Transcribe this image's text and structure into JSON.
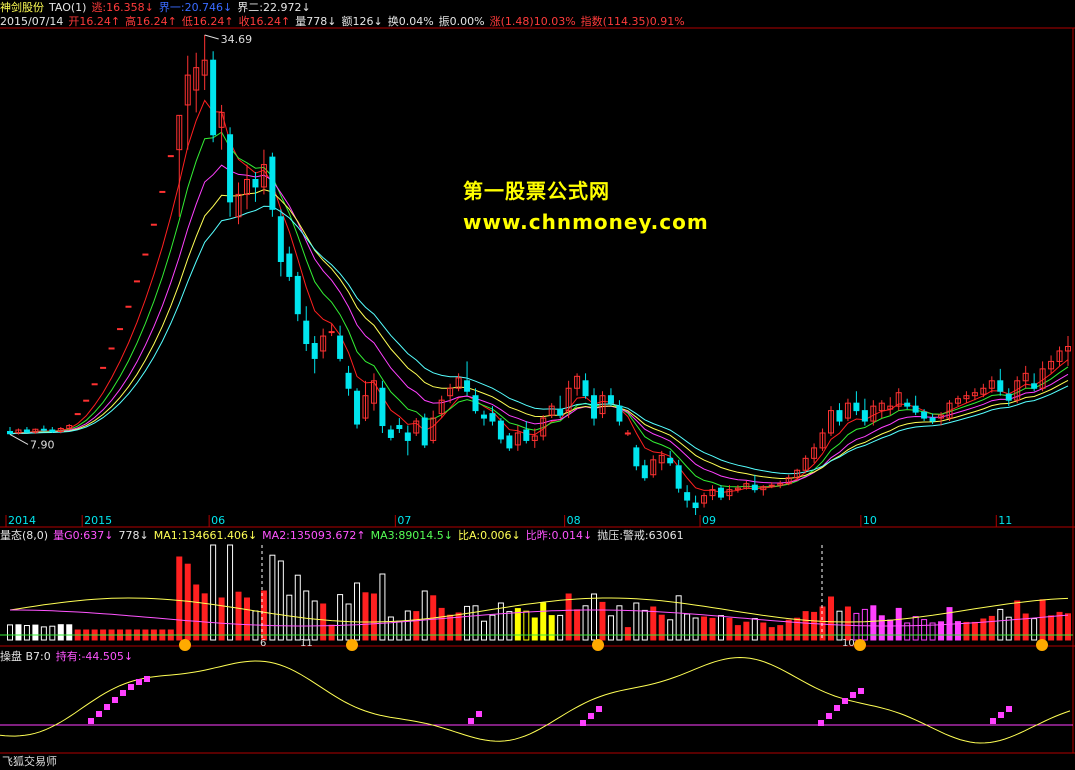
{
  "header": {
    "stock_name": "神剑股份",
    "indicator_name": "TAO(1)",
    "line1_items": [
      {
        "text": "逃:16.358↓",
        "color": "#ff3b3b"
      },
      {
        "text": "界一:20.746↓",
        "color": "#3a6bff"
      },
      {
        "text": "界二:22.972↓",
        "color": "#e5e5e5"
      }
    ],
    "date": "2015/07/14",
    "line2_items": [
      {
        "text": "开16.24↑",
        "color": "#ff3b3b"
      },
      {
        "text": "高16.24↑",
        "color": "#ff3b3b"
      },
      {
        "text": "低16.24↑",
        "color": "#ff3b3b"
      },
      {
        "text": "收16.24↑",
        "color": "#ff3b3b"
      },
      {
        "text": "量778↓",
        "color": "#e5e5e5"
      },
      {
        "text": "额126↓",
        "color": "#e5e5e5"
      },
      {
        "text": "换0.04%",
        "color": "#e5e5e5"
      },
      {
        "text": "振0.00%",
        "color": "#e5e5e5"
      },
      {
        "text": "涨(1.48)10.03%",
        "color": "#ff3b3b"
      },
      {
        "text": "指数(114.35)0.91%",
        "color": "#ff3b3b"
      }
    ]
  },
  "watermark": {
    "line1": "第一股票公式网",
    "line2": "www.chnmoney.com"
  },
  "volume_panel": {
    "label": "量态(8,0)",
    "items": [
      {
        "text": "量G0:637↓",
        "color": "#ff55ff"
      },
      {
        "text": "778↓",
        "color": "#e5e5e5"
      },
      {
        "text": "MA1:134661.406↓",
        "color": "#ffff55"
      },
      {
        "text": "MA2:135093.672↑",
        "color": "#ff55ff"
      },
      {
        "text": "MA3:89014.5↓",
        "color": "#55ff55"
      },
      {
        "text": "比A:0.006↓",
        "color": "#ffff55"
      },
      {
        "text": "比昨:0.014↓",
        "color": "#ff55ff"
      },
      {
        "text": "抛压:警戒:63061",
        "color": "#e5e5e5"
      }
    ],
    "markers": [
      "6",
      "11",
      "10"
    ]
  },
  "osc_panel": {
    "label": "操盘 B7:0",
    "items": [
      {
        "text": "持有:-44.505↓",
        "color": "#ff55ff"
      }
    ]
  },
  "footer": {
    "text": "飞狐交易师"
  },
  "colors": {
    "up": "#ff3232",
    "down": "#00e5ee",
    "ma_red": "#ff2020",
    "ma_magenta": "#ff40ff",
    "ma_yellow": "#ffff55",
    "ma_green": "#33ee33",
    "ma_cyan": "#55ffff",
    "axis": "#b00000"
  },
  "chart_data": {
    "type": "candlestick",
    "x_tick_labels": [
      "2014",
      "2015",
      "06",
      "07",
      "08",
      "09",
      "10",
      "11"
    ],
    "price_annotations": {
      "max": "34.69",
      "min": "7.90"
    },
    "candles": [
      {
        "o": 8.1,
        "h": 8.4,
        "l": 7.9,
        "c": 7.95
      },
      {
        "o": 8.0,
        "h": 8.3,
        "l": 7.9,
        "c": 8.2
      },
      {
        "o": 8.2,
        "h": 8.4,
        "l": 8.0,
        "c": 8.05
      },
      {
        "o": 8.05,
        "h": 8.3,
        "l": 7.95,
        "c": 8.25
      },
      {
        "o": 8.25,
        "h": 8.5,
        "l": 8.1,
        "c": 8.2
      },
      {
        "o": 8.2,
        "h": 8.4,
        "l": 8.0,
        "c": 8.1
      },
      {
        "o": 8.1,
        "h": 8.4,
        "l": 7.98,
        "c": 8.3
      },
      {
        "o": 8.3,
        "h": 8.6,
        "l": 8.2,
        "c": 8.5
      },
      {
        "o": 9.3,
        "h": 9.3,
        "l": 9.3,
        "c": 9.3
      },
      {
        "o": 10.2,
        "h": 10.2,
        "l": 10.2,
        "c": 10.2
      },
      {
        "o": 11.3,
        "h": 11.3,
        "l": 11.3,
        "c": 11.3
      },
      {
        "o": 12.4,
        "h": 12.4,
        "l": 12.4,
        "c": 12.4
      },
      {
        "o": 13.7,
        "h": 13.7,
        "l": 13.7,
        "c": 13.7
      },
      {
        "o": 15.0,
        "h": 15.0,
        "l": 15.0,
        "c": 15.0
      },
      {
        "o": 16.5,
        "h": 16.5,
        "l": 16.5,
        "c": 16.5
      },
      {
        "o": 18.2,
        "h": 18.2,
        "l": 18.2,
        "c": 18.2
      },
      {
        "o": 20.0,
        "h": 20.0,
        "l": 20.0,
        "c": 20.0
      },
      {
        "o": 22.0,
        "h": 22.0,
        "l": 22.0,
        "c": 22.0
      },
      {
        "o": 24.2,
        "h": 24.2,
        "l": 24.2,
        "c": 24.2
      },
      {
        "o": 26.6,
        "h": 26.6,
        "l": 26.6,
        "c": 26.6
      },
      {
        "o": 27.0,
        "h": 29.3,
        "l": 22.5,
        "c": 29.3
      },
      {
        "o": 30.0,
        "h": 33.3,
        "l": 27.0,
        "c": 32.0
      },
      {
        "o": 31.0,
        "h": 33.5,
        "l": 29.5,
        "c": 32.5
      },
      {
        "o": 32.0,
        "h": 34.69,
        "l": 31.0,
        "c": 33.0
      },
      {
        "o": 33.0,
        "h": 33.6,
        "l": 27.5,
        "c": 28.0
      },
      {
        "o": 28.5,
        "h": 30.0,
        "l": 27.0,
        "c": 29.5
      },
      {
        "o": 28.0,
        "h": 28.5,
        "l": 22.5,
        "c": 23.5
      },
      {
        "o": 22.5,
        "h": 24.8,
        "l": 22.0,
        "c": 24.0
      },
      {
        "o": 24.0,
        "h": 26.0,
        "l": 23.0,
        "c": 25.0
      },
      {
        "o": 25.0,
        "h": 25.5,
        "l": 23.5,
        "c": 24.5
      },
      {
        "o": 24.5,
        "h": 27.0,
        "l": 24.0,
        "c": 26.0
      },
      {
        "o": 26.5,
        "h": 26.8,
        "l": 22.5,
        "c": 23.0
      },
      {
        "o": 22.5,
        "h": 23.0,
        "l": 18.5,
        "c": 19.5
      },
      {
        "o": 20.0,
        "h": 20.5,
        "l": 18.2,
        "c": 18.5
      },
      {
        "o": 18.5,
        "h": 18.8,
        "l": 15.5,
        "c": 16.0
      },
      {
        "o": 15.5,
        "h": 16.5,
        "l": 13.5,
        "c": 14.0
      },
      {
        "o": 14.0,
        "h": 14.5,
        "l": 12.0,
        "c": 13.0
      },
      {
        "o": 13.5,
        "h": 15.0,
        "l": 13.0,
        "c": 14.5
      },
      {
        "o": 14.8,
        "h": 15.3,
        "l": 14.5,
        "c": 14.8
      },
      {
        "o": 14.5,
        "h": 15.2,
        "l": 12.8,
        "c": 13.0
      },
      {
        "o": 12.0,
        "h": 12.5,
        "l": 10.5,
        "c": 11.0
      },
      {
        "o": 10.8,
        "h": 11.0,
        "l": 8.3,
        "c": 8.6
      },
      {
        "o": 9.0,
        "h": 11.5,
        "l": 8.8,
        "c": 10.5
      },
      {
        "o": 10.0,
        "h": 12.0,
        "l": 9.5,
        "c": 11.5
      },
      {
        "o": 11.0,
        "h": 11.5,
        "l": 8.0,
        "c": 8.5
      },
      {
        "o": 8.2,
        "h": 8.5,
        "l": 7.5,
        "c": 7.7
      },
      {
        "o": 8.5,
        "h": 9.0,
        "l": 8.0,
        "c": 8.3
      },
      {
        "o": 8.0,
        "h": 8.5,
        "l": 6.5,
        "c": 7.5
      },
      {
        "o": 8.0,
        "h": 9.0,
        "l": 7.8,
        "c": 8.8
      },
      {
        "o": 9.0,
        "h": 9.3,
        "l": 7.0,
        "c": 7.2
      },
      {
        "o": 7.5,
        "h": 9.5,
        "l": 7.3,
        "c": 9.0
      },
      {
        "o": 9.3,
        "h": 10.5,
        "l": 9.0,
        "c": 10.2
      },
      {
        "o": 10.5,
        "h": 11.3,
        "l": 10.0,
        "c": 11.0
      },
      {
        "o": 11.0,
        "h": 12.0,
        "l": 10.8,
        "c": 11.7
      },
      {
        "o": 11.5,
        "h": 12.8,
        "l": 10.5,
        "c": 10.8
      },
      {
        "o": 10.5,
        "h": 11.0,
        "l": 9.3,
        "c": 9.5
      },
      {
        "o": 9.2,
        "h": 9.5,
        "l": 8.5,
        "c": 9.0
      },
      {
        "o": 9.3,
        "h": 9.8,
        "l": 8.5,
        "c": 8.8
      },
      {
        "o": 8.8,
        "h": 9.0,
        "l": 7.3,
        "c": 7.6
      },
      {
        "o": 7.8,
        "h": 8.0,
        "l": 6.8,
        "c": 7.0
      },
      {
        "o": 7.2,
        "h": 8.5,
        "l": 6.8,
        "c": 8.0
      },
      {
        "o": 8.2,
        "h": 8.8,
        "l": 7.3,
        "c": 7.5
      },
      {
        "o": 7.5,
        "h": 8.3,
        "l": 7.0,
        "c": 7.8
      },
      {
        "o": 7.8,
        "h": 9.2,
        "l": 7.5,
        "c": 9.0
      },
      {
        "o": 9.2,
        "h": 10.0,
        "l": 9.0,
        "c": 9.8
      },
      {
        "o": 9.6,
        "h": 10.5,
        "l": 9.0,
        "c": 9.2
      },
      {
        "o": 9.5,
        "h": 11.5,
        "l": 9.0,
        "c": 11.0
      },
      {
        "o": 11.0,
        "h": 12.0,
        "l": 10.5,
        "c": 11.8
      },
      {
        "o": 11.5,
        "h": 12.0,
        "l": 10.3,
        "c": 10.5
      },
      {
        "o": 10.5,
        "h": 11.0,
        "l": 8.5,
        "c": 9.0
      },
      {
        "o": 9.3,
        "h": 10.8,
        "l": 9.0,
        "c": 10.5
      },
      {
        "o": 10.5,
        "h": 11.0,
        "l": 9.8,
        "c": 10.0
      },
      {
        "o": 9.8,
        "h": 10.2,
        "l": 8.5,
        "c": 8.8
      },
      {
        "o": 8.0,
        "h": 8.2,
        "l": 7.8,
        "c": 8.0
      },
      {
        "o": 7.0,
        "h": 7.2,
        "l": 5.5,
        "c": 5.8
      },
      {
        "o": 5.8,
        "h": 6.2,
        "l": 4.8,
        "c": 5.0
      },
      {
        "o": 5.2,
        "h": 6.5,
        "l": 5.0,
        "c": 6.2
      },
      {
        "o": 6.0,
        "h": 6.8,
        "l": 5.5,
        "c": 6.5
      },
      {
        "o": 6.3,
        "h": 6.8,
        "l": 5.8,
        "c": 6.0
      },
      {
        "o": 5.8,
        "h": 6.2,
        "l": 4.0,
        "c": 4.3
      },
      {
        "o": 4.0,
        "h": 4.5,
        "l": 3.0,
        "c": 3.5
      },
      {
        "o": 3.3,
        "h": 3.8,
        "l": 2.5,
        "c": 3.0
      },
      {
        "o": 3.3,
        "h": 4.0,
        "l": 3.0,
        "c": 3.8
      },
      {
        "o": 3.8,
        "h": 4.5,
        "l": 3.5,
        "c": 4.2
      },
      {
        "o": 4.3,
        "h": 4.5,
        "l": 3.5,
        "c": 3.7
      },
      {
        "o": 3.8,
        "h": 4.5,
        "l": 3.5,
        "c": 4.2
      },
      {
        "o": 4.2,
        "h": 4.5,
        "l": 4.0,
        "c": 4.3
      },
      {
        "o": 4.3,
        "h": 4.8,
        "l": 4.2,
        "c": 4.6
      },
      {
        "o": 4.5,
        "h": 5.2,
        "l": 4.0,
        "c": 4.2
      },
      {
        "o": 4.2,
        "h": 4.5,
        "l": 3.8,
        "c": 4.4
      },
      {
        "o": 4.5,
        "h": 4.7,
        "l": 4.3,
        "c": 4.5
      },
      {
        "o": 4.5,
        "h": 4.8,
        "l": 4.3,
        "c": 4.6
      },
      {
        "o": 4.6,
        "h": 5.2,
        "l": 4.5,
        "c": 5.0
      },
      {
        "o": 5.0,
        "h": 5.6,
        "l": 4.8,
        "c": 5.5
      },
      {
        "o": 5.5,
        "h": 6.5,
        "l": 5.3,
        "c": 6.3
      },
      {
        "o": 6.3,
        "h": 7.3,
        "l": 6.0,
        "c": 7.0
      },
      {
        "o": 7.0,
        "h": 8.3,
        "l": 6.8,
        "c": 8.0
      },
      {
        "o": 8.0,
        "h": 9.8,
        "l": 7.8,
        "c": 9.5
      },
      {
        "o": 9.5,
        "h": 10.0,
        "l": 8.5,
        "c": 8.8
      },
      {
        "o": 9.0,
        "h": 10.3,
        "l": 8.8,
        "c": 10.0
      },
      {
        "o": 10.0,
        "h": 10.8,
        "l": 9.2,
        "c": 9.5
      },
      {
        "o": 9.5,
        "h": 10.3,
        "l": 8.5,
        "c": 8.8
      },
      {
        "o": 8.8,
        "h": 10.2,
        "l": 8.5,
        "c": 9.8
      },
      {
        "o": 9.5,
        "h": 10.2,
        "l": 9.0,
        "c": 10.0
      },
      {
        "o": 9.6,
        "h": 10.4,
        "l": 9.2,
        "c": 9.8
      },
      {
        "o": 9.8,
        "h": 11.0,
        "l": 9.5,
        "c": 10.7
      },
      {
        "o": 10.0,
        "h": 10.3,
        "l": 9.6,
        "c": 9.8
      },
      {
        "o": 9.8,
        "h": 10.5,
        "l": 9.2,
        "c": 9.4
      },
      {
        "o": 9.4,
        "h": 9.6,
        "l": 8.8,
        "c": 9.0
      },
      {
        "o": 9.0,
        "h": 9.3,
        "l": 8.6,
        "c": 8.8
      },
      {
        "o": 9.0,
        "h": 9.4,
        "l": 8.5,
        "c": 9.2
      },
      {
        "o": 9.0,
        "h": 10.2,
        "l": 8.8,
        "c": 10.0
      },
      {
        "o": 10.0,
        "h": 10.5,
        "l": 9.8,
        "c": 10.3
      },
      {
        "o": 10.3,
        "h": 10.8,
        "l": 10.0,
        "c": 10.5
      },
      {
        "o": 10.5,
        "h": 11.0,
        "l": 10.2,
        "c": 10.7
      },
      {
        "o": 10.6,
        "h": 11.3,
        "l": 10.4,
        "c": 11.0
      },
      {
        "o": 11.0,
        "h": 11.8,
        "l": 10.7,
        "c": 11.5
      },
      {
        "o": 11.5,
        "h": 12.3,
        "l": 10.5,
        "c": 10.8
      },
      {
        "o": 10.6,
        "h": 11.0,
        "l": 9.8,
        "c": 10.2
      },
      {
        "o": 10.2,
        "h": 11.8,
        "l": 10.0,
        "c": 11.5
      },
      {
        "o": 11.5,
        "h": 12.5,
        "l": 11.0,
        "c": 12.0
      },
      {
        "o": 11.3,
        "h": 12.0,
        "l": 10.8,
        "c": 11.0
      },
      {
        "o": 11.0,
        "h": 12.8,
        "l": 10.8,
        "c": 12.3
      },
      {
        "o": 12.3,
        "h": 13.2,
        "l": 12.0,
        "c": 12.8
      },
      {
        "o": 12.8,
        "h": 13.8,
        "l": 12.5,
        "c": 13.5
      },
      {
        "o": 13.5,
        "h": 14.5,
        "l": 12.5,
        "c": 13.8
      }
    ]
  }
}
